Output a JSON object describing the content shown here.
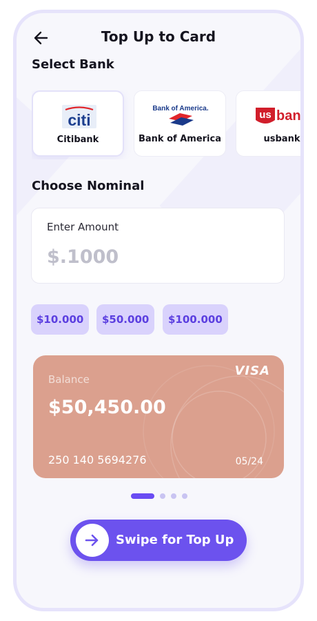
{
  "header": {
    "title": "Top Up to Card",
    "back_icon": "arrow-left-icon"
  },
  "select_bank": {
    "label": "Select Bank",
    "banks": [
      {
        "name": "Citibank",
        "logo_text": "citi",
        "selected": true
      },
      {
        "name": "Bank of America",
        "logo_text": "Bank of America.",
        "selected": false
      },
      {
        "name": "usbank",
        "logo_text_a": "us",
        "logo_text_b": "bank",
        "selected": false
      }
    ]
  },
  "nominal": {
    "label": "Choose Nominal",
    "amount_label": "Enter Amount",
    "amount_value": "$.1000",
    "chips": [
      "$10.000",
      "$50.000",
      "$100.000"
    ]
  },
  "card": {
    "brand": "VISA",
    "balance_label": "Balance",
    "balance": "$50,450.00",
    "number": "250 140 5694276",
    "expiry": "05/24",
    "color": "#dba08e"
  },
  "pager": {
    "count": 4,
    "active_index": 0
  },
  "swipe": {
    "label": "Swipe for Top Up",
    "icon": "arrow-right-icon"
  },
  "colors": {
    "accent": "#6c52ee",
    "chip_bg": "#d9d2fc",
    "chip_text": "#5b3fe0"
  }
}
